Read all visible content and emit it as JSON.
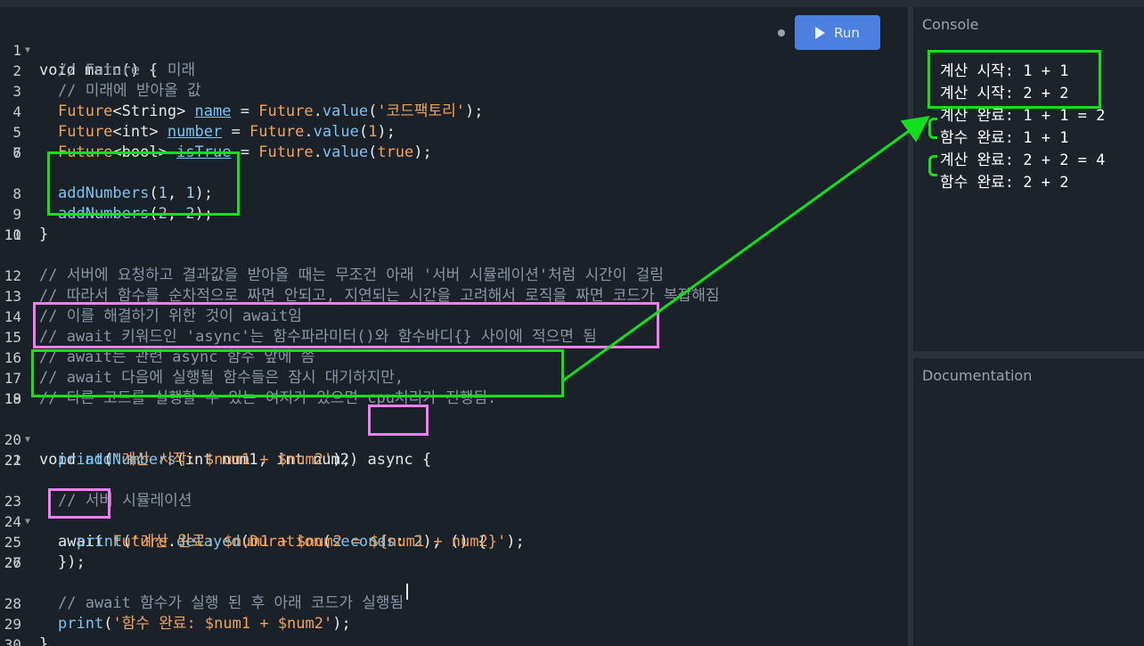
{
  "toolbar": {
    "run_label": "Run"
  },
  "panels": {
    "console_title": "Console",
    "docs_title": "Documentation"
  },
  "code": {
    "l1": "void main() {",
    "l2": "// Future - 미래",
    "l3": "// 미래에 받아올 값",
    "l4": [
      "Future",
      "<String> ",
      "name",
      " = ",
      "Future",
      ".",
      "value",
      "(",
      "'코드팩토리'",
      ");"
    ],
    "l5": [
      "Future",
      "<int> ",
      "number",
      " = ",
      "Future",
      ".",
      "value",
      "(",
      "1",
      ");"
    ],
    "l6": [
      "Future",
      "<bool> ",
      "isTrue",
      " = ",
      "Future",
      ".",
      "value",
      "(",
      "true",
      ");"
    ],
    "l8": [
      "addNumbers",
      "(",
      "1",
      ", ",
      "1",
      ");"
    ],
    "l9": [
      "addNumbers",
      "(",
      "2",
      ", ",
      "2",
      ");"
    ],
    "l10": "}",
    "l12": "// 서버에 요청하고 결과값을 받아올 때는 무조건 아래 '서버 시뮬레이션'처럼 시간이 걸림",
    "l13": "// 따라서 함수를 순차적으로 짜면 안되고, 지연되는 시간을 고려해서 로직을 짜면 코드가 복잡해짐",
    "l14": "// 이를 해결하기 위한 것이 await임",
    "l15": "// await 키워드인 'async'는 함수파라미터()와 함수바디{} 사이에 적으면 됨",
    "l16": "// await는 관련 async 함수 앞에 씀",
    "l17": "// await 다음에 실행될 함수들은 잠시 대기하지만,",
    "l18": "// 다른 코드를 실행할 수 있는 여지가 있으면 cpu처리가 진행됨.",
    "l20": [
      "void ",
      "addNumbers",
      "(int num1, int num2) ",
      "async",
      " {"
    ],
    "l21": [
      "print",
      "(",
      "'계산 시작: $num1 + $num2'",
      ");"
    ],
    "l23": "// 서버 시뮬레이션",
    "l24": [
      "await",
      " ",
      "Future",
      ".",
      "delayed",
      "(",
      "Duration",
      "(",
      "seconds",
      ": ",
      "2",
      "), () {"
    ],
    "l25": [
      "print",
      "(",
      "'계산 완료: $num1 + $num2 = ${num1 + num2}'",
      ");"
    ],
    "l26": "});",
    "l28": "// await 함수가 실행 된 후 아래 코드가 실행됨",
    "l29": [
      "print",
      "(",
      "'함수 완료: $num1 + $num2'",
      ");"
    ],
    "l30": "}"
  },
  "console_output": [
    "계산 시작: 1 + 1",
    "계산 시작: 2 + 2",
    "계산 완료: 1 + 1 = 2",
    "함수 완료: 1 + 1",
    "계산 완료: 2 + 2 = 4",
    "함수 완료: 2 + 2"
  ],
  "colors": {
    "annotation_green": "#13e01d",
    "annotation_pink": "#f07ef0",
    "run_button": "#4c7fe0"
  }
}
